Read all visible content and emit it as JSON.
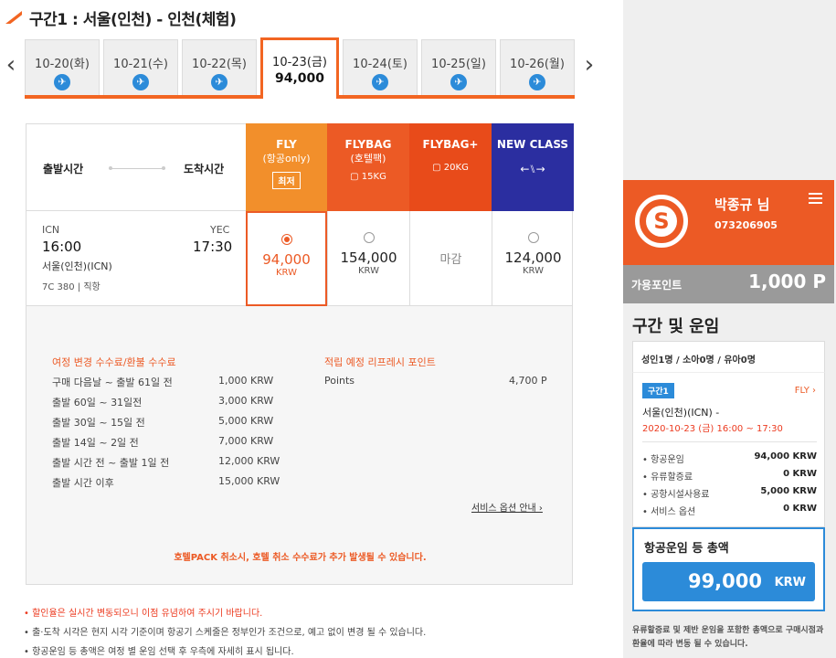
{
  "section": {
    "title": "구간1 :  서울(인천) -  인천(체험)"
  },
  "date_tabs": [
    {
      "date": "10-20(화)",
      "price": ""
    },
    {
      "date": "10-21(수)",
      "price": ""
    },
    {
      "date": "10-22(목)",
      "price": ""
    },
    {
      "date": "10-23(금)",
      "price": "94,000"
    },
    {
      "date": "10-24(토)",
      "price": ""
    },
    {
      "date": "10-25(일)",
      "price": ""
    },
    {
      "date": "10-26(월)",
      "price": ""
    }
  ],
  "nav": {
    "prev": "‹",
    "next": "›"
  },
  "table_head": {
    "depart": "출발시간",
    "arrive": "도착시간"
  },
  "classes": [
    {
      "name": "FLY",
      "sub": "(항공only)",
      "extra": "최저"
    },
    {
      "name": "FLYBAG",
      "sub": "(호텔팩)",
      "extra": "15KG"
    },
    {
      "name": "FLYBAG+",
      "sub": "",
      "extra": "20KG"
    },
    {
      "name": "NEW CLASS",
      "sub": "",
      "extra": ""
    }
  ],
  "flight": {
    "from_code": "ICN",
    "to_code": "YEC",
    "depart_time": "16:00",
    "arrive_time": "17:30",
    "city": "서울(인천)(ICN)",
    "flight_no": "7C 380",
    "type": "직항"
  },
  "prices": [
    {
      "amount": "94,000",
      "currency": "KRW",
      "selected": true
    },
    {
      "amount": "154,000",
      "currency": "KRW",
      "selected": false
    },
    {
      "status": "마감"
    },
    {
      "amount": "124,000",
      "currency": "KRW",
      "selected": false
    }
  ],
  "fees": {
    "title": "여정 변경 수수료/환불 수수료",
    "rows": [
      {
        "label": "구매 다음날 ~ 출발 61일 전",
        "value": "1,000 KRW"
      },
      {
        "label": "출발 60일 ~ 31일전",
        "value": "3,000 KRW"
      },
      {
        "label": "출발 30일 ~ 15일 전",
        "value": "5,000 KRW"
      },
      {
        "label": "출발 14일 ~ 2일 전",
        "value": "7,000 KRW"
      },
      {
        "label": "출발 시간 전 ~ 출발 1일 전",
        "value": "12,000 KRW"
      },
      {
        "label": "출발 시간 이후",
        "value": "15,000 KRW"
      }
    ]
  },
  "points_info": {
    "title": "적립 예정 리프레시 포인트",
    "label": "Points",
    "value": "4,700 P"
  },
  "service_link": "서비스 옵션 안내 ›",
  "hotel_note": "호텔PACK 취소시, 호텔 취소 수수료가 추가 발생될 수 있습니다.",
  "notes": [
    "• 할인율은 실시간 변동되오니 이점 유념하여 주시기 바랍니다.",
    "• 출·도착 시각은 현지 시각 기준이며 항공기 스케줄은 정부인가 조건으로, 예고 없이 변경 될 수 있습니다.",
    "• 항공운임 등 총액은 여정 별 운임 선택 후 우측에 자세히 표시 됩니다."
  ],
  "user": {
    "name": "박종규 님",
    "id": "073206905",
    "points_label": "가용포인트",
    "points": "1,000 P"
  },
  "summary": {
    "title": "구간 및 운임",
    "pax": "성인1명 / 소아0명 / 유아0명",
    "segment_badge": "구간1",
    "segment_class": "FLY ›",
    "route": "서울(인천)(ICN) -",
    "datetime": "2020-10-23 (금) 16:00 ~ 17:30",
    "lines": [
      {
        "label": "• 항공운임",
        "value": "94,000 KRW"
      },
      {
        "label": "• 유류할증료",
        "value": "0 KRW"
      },
      {
        "label": "• 공항시설사용료",
        "value": "5,000 KRW"
      },
      {
        "label": "• 서비스 옵션",
        "value": "0 KRW"
      }
    ],
    "total_label": "항공운임 등 총액",
    "total": "99,000",
    "total_currency": "KRW",
    "footer": "유류할증료 및 제반 운임을 포함한 총액으로 구매시점과 환율에 따라 변동 될 수 있습니다."
  },
  "colors": {
    "accent": "#ec5a25",
    "fly": "#f28f2b",
    "new_class": "#2b2ea0",
    "blue": "#2c8bd9"
  }
}
